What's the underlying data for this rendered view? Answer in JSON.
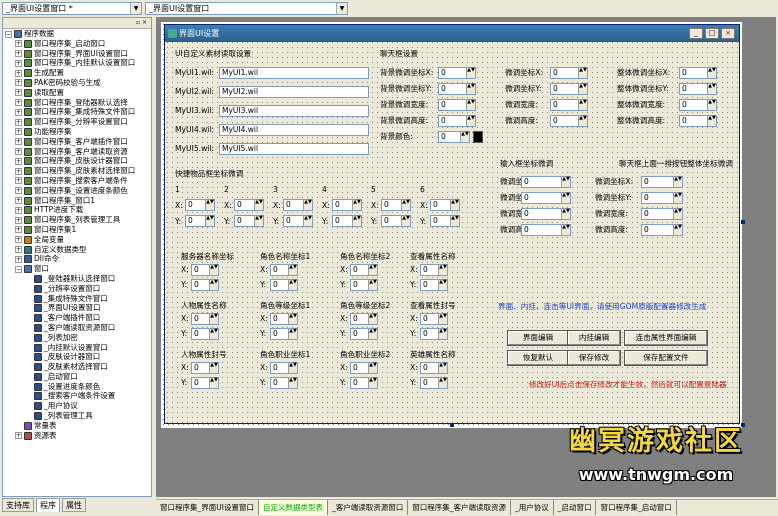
{
  "toolbar": {
    "combo_left": "_界面UI设置窗口 *",
    "combo_right": "_界面UI设置窗口"
  },
  "tree": {
    "header_icons": "▫ ×",
    "items": [
      {
        "label": "程序数据",
        "ex": "−",
        "icon": "folder-icon",
        "color": "#4a6fa5",
        "level": 0
      },
      {
        "label": "窗口程序集_启动窗口",
        "ex": "+",
        "icon": "module-icon",
        "color": "#5b8c3a",
        "level": 1
      },
      {
        "label": "窗口程序集_界面UI设置窗口",
        "ex": "+",
        "icon": "module-icon",
        "color": "#5b8c3a",
        "level": 1
      },
      {
        "label": "窗口程序集_内挂默认设置窗口",
        "ex": "+",
        "icon": "module-icon",
        "color": "#5b8c3a",
        "level": 1
      },
      {
        "label": "生成配置",
        "ex": "+",
        "icon": "module-icon",
        "color": "#5b8c3a",
        "level": 1
      },
      {
        "label": "PAK密码校验与生成",
        "ex": "+",
        "icon": "module-icon",
        "color": "#5b8c3a",
        "level": 1
      },
      {
        "label": "读取配置",
        "ex": "+",
        "icon": "module-icon",
        "color": "#5b8c3a",
        "level": 1
      },
      {
        "label": "窗口程序集_登陆器默认选择",
        "ex": "+",
        "icon": "module-icon",
        "color": "#5b8c3a",
        "level": 1
      },
      {
        "label": "窗口程序集_集成特殊文件窗口",
        "ex": "+",
        "icon": "module-icon",
        "color": "#5b8c3a",
        "level": 1
      },
      {
        "label": "窗口程序集_分辨率设置窗口",
        "ex": "+",
        "icon": "module-icon",
        "color": "#5b8c3a",
        "level": 1
      },
      {
        "label": "功能程序集",
        "ex": "+",
        "icon": "module-icon",
        "color": "#5b8c3a",
        "level": 1
      },
      {
        "label": "窗口程序集_客户端插件窗口",
        "ex": "+",
        "icon": "module-icon",
        "color": "#5b8c3a",
        "level": 1
      },
      {
        "label": "窗口程序集_客户端读取资源",
        "ex": "+",
        "icon": "module-icon",
        "color": "#5b8c3a",
        "level": 1
      },
      {
        "label": "窗口程序集_皮肤设计器窗口",
        "ex": "+",
        "icon": "module-icon",
        "color": "#5b8c3a",
        "level": 1
      },
      {
        "label": "窗口程序集_皮肤素材选择窗口",
        "ex": "+",
        "icon": "module-icon",
        "color": "#5b8c3a",
        "level": 1
      },
      {
        "label": "窗口程序集_搜索客户端条件",
        "ex": "+",
        "icon": "module-icon",
        "color": "#5b8c3a",
        "level": 1
      },
      {
        "label": "窗口程序集_设置进度条颜色",
        "ex": "+",
        "icon": "module-icon",
        "color": "#5b8c3a",
        "level": 1
      },
      {
        "label": "窗口程序集_窗口1",
        "ex": "+",
        "icon": "module-icon",
        "color": "#5b8c3a",
        "level": 1
      },
      {
        "label": "HTTP进度下载",
        "ex": "+",
        "icon": "module-icon",
        "color": "#5b8c3a",
        "level": 1
      },
      {
        "label": "窗口程序集_列表管理工具",
        "ex": "+",
        "icon": "module-icon",
        "color": "#5b8c3a",
        "level": 1
      },
      {
        "label": "窗口程序集1",
        "ex": "+",
        "icon": "module-icon",
        "color": "#5b8c3a",
        "level": 1
      },
      {
        "label": "全局变量",
        "ex": "+",
        "icon": "globe-icon",
        "color": "#b8860b",
        "level": 1
      },
      {
        "label": "自定义数据类型",
        "ex": "+",
        "icon": "type-icon",
        "color": "#2e7d7d",
        "level": 1
      },
      {
        "label": "Dll命令",
        "ex": "+",
        "icon": "dll-icon",
        "color": "#2e5d9d",
        "level": 1
      },
      {
        "label": "窗口",
        "ex": "−",
        "icon": "folder-icon",
        "color": "#4a6fa5",
        "level": 1
      },
      {
        "label": "_登陆器默认选择窗口",
        "ex": "",
        "icon": "window-icon",
        "color": "#2a4f8a",
        "level": 2
      },
      {
        "label": "_分辨率设置窗口",
        "ex": "",
        "icon": "window-icon",
        "color": "#2a4f8a",
        "level": 2
      },
      {
        "label": "_集成特殊文件窗口",
        "ex": "",
        "icon": "window-icon",
        "color": "#2a4f8a",
        "level": 2
      },
      {
        "label": "_界面UI设置窗口",
        "ex": "",
        "icon": "window-icon",
        "color": "#2a4f8a",
        "level": 2
      },
      {
        "label": "_客户端插件窗口",
        "ex": "",
        "icon": "window-icon",
        "color": "#2a4f8a",
        "level": 2
      },
      {
        "label": "_客户端读取资源窗口",
        "ex": "",
        "icon": "window-icon",
        "color": "#2a4f8a",
        "level": 2
      },
      {
        "label": "_列表加密",
        "ex": "",
        "icon": "window-icon",
        "color": "#2a4f8a",
        "level": 2
      },
      {
        "label": "_内挂默认设置窗口",
        "ex": "",
        "icon": "window-icon",
        "color": "#2a4f8a",
        "level": 2
      },
      {
        "label": "_皮肤设计器窗口",
        "ex": "",
        "icon": "window-icon",
        "color": "#2a4f8a",
        "level": 2
      },
      {
        "label": "_皮肤素材选择窗口",
        "ex": "",
        "icon": "window-icon",
        "color": "#2a4f8a",
        "level": 2
      },
      {
        "label": "_启动窗口",
        "ex": "",
        "icon": "window-icon",
        "color": "#2a4f8a",
        "level": 2
      },
      {
        "label": "_设置进度条颜色",
        "ex": "",
        "icon": "window-icon",
        "color": "#2a4f8a",
        "level": 2
      },
      {
        "label": "_搜索客户端条件设置",
        "ex": "",
        "icon": "window-icon",
        "color": "#2a4f8a",
        "level": 2
      },
      {
        "label": "_用户协议",
        "ex": "",
        "icon": "window-icon",
        "color": "#2a4f8a",
        "level": 2
      },
      {
        "label": "_列表管理工具",
        "ex": "",
        "icon": "window-icon",
        "color": "#2a4f8a",
        "level": 2
      },
      {
        "label": "常量表",
        "ex": "",
        "icon": "const-icon",
        "color": "#7a4fa5",
        "level": 1
      },
      {
        "label": "资源表",
        "ex": "+",
        "icon": "resource-icon",
        "color": "#a54f4f",
        "level": 1
      }
    ]
  },
  "bottom_tabs": [
    {
      "label": "支持库",
      "active": false
    },
    {
      "label": "程序",
      "active": true
    },
    {
      "label": "属性",
      "active": false
    }
  ],
  "window": {
    "title": "界面UI设置",
    "controls": [
      "_",
      "□",
      "×"
    ]
  },
  "wil": {
    "heading": "UI自定义素材读取设置",
    "rows": [
      {
        "label": "MyUI1.wil:",
        "value": "MyUI1.wil"
      },
      {
        "label": "MyUI2.wil:",
        "value": "MyUI2.wil"
      },
      {
        "label": "MyUI3.wil:",
        "value": "MyUI3.wil"
      },
      {
        "label": "MyUI4.wil:",
        "value": "MyUI4.wil"
      },
      {
        "label": "MyUI5.wil:",
        "value": "MyUI5.wil"
      }
    ]
  },
  "chat": {
    "heading": "聊天框设置",
    "col1": [
      {
        "label": "背景微调坐标X:",
        "value": "0"
      },
      {
        "label": "背景微调坐标Y:",
        "value": "0"
      },
      {
        "label": "背景微调宽度:",
        "value": "0"
      },
      {
        "label": "背景微调高度:",
        "value": "0"
      }
    ],
    "col2": [
      {
        "label": "微调坐标X:",
        "value": "0"
      },
      {
        "label": "微调坐标Y:",
        "value": "0"
      },
      {
        "label": "微调宽度:",
        "value": "0"
      },
      {
        "label": "微调高度:",
        "value": "0"
      }
    ],
    "col3": [
      {
        "label": "整体微调坐标X:",
        "value": "0"
      },
      {
        "label": "整体微调坐标Y:",
        "value": "0"
      },
      {
        "label": "整体微调宽度:",
        "value": "0"
      },
      {
        "label": "整体微调高度:",
        "value": "0"
      }
    ],
    "color_label": "背景颜色:",
    "color_value": "0",
    "swatch": "#000000"
  },
  "input_box": {
    "heading": "输入框坐标微调",
    "rows": [
      {
        "label": "微调坐标X:",
        "value": "0"
      },
      {
        "label": "微调坐标Y:",
        "value": "0"
      },
      {
        "label": "微调宽度:",
        "value": "0"
      },
      {
        "label": "微调高度:",
        "value": "0"
      }
    ]
  },
  "chat_buttons": {
    "heading": "聊天框上面一排按钮整体坐标微调",
    "rows": [
      {
        "label": "微调坐标X:",
        "value": "0"
      },
      {
        "label": "微调坐标Y:",
        "value": "0"
      },
      {
        "label": "微调宽度:",
        "value": "0"
      },
      {
        "label": "微调高度:",
        "value": "0"
      }
    ]
  },
  "quick": {
    "heading": "快捷物品框坐标微调",
    "slots": [
      {
        "num": "1",
        "x": "0",
        "y": "0"
      },
      {
        "num": "2",
        "x": "0",
        "y": "0"
      },
      {
        "num": "3",
        "x": "0",
        "y": "0"
      },
      {
        "num": "4",
        "x": "0",
        "y": "0"
      },
      {
        "num": "5",
        "x": "0",
        "y": "0"
      },
      {
        "num": "6",
        "x": "0",
        "y": "0"
      }
    ]
  },
  "coords": [
    {
      "label": "服务器名称坐标",
      "x": "0",
      "y": "0"
    },
    {
      "label": "角色名称坐标1",
      "x": "0",
      "y": "0"
    },
    {
      "label": "角色名称坐标2",
      "x": "0",
      "y": "0"
    },
    {
      "label": "查看属性名称",
      "x": "0",
      "y": "0"
    },
    {
      "label": "人物属性名称",
      "x": "0",
      "y": "0"
    },
    {
      "label": "角色等级坐标1",
      "x": "0",
      "y": "0"
    },
    {
      "label": "角色等级坐标2",
      "x": "0",
      "y": "0"
    },
    {
      "label": "查看属性封号",
      "x": "0",
      "y": "0"
    },
    {
      "label": "人物属性封号",
      "x": "0",
      "y": "0"
    },
    {
      "label": "角色职业坐标1",
      "x": "0",
      "y": "0"
    },
    {
      "label": "角色职业坐标2",
      "x": "0",
      "y": "0"
    },
    {
      "label": "英雄属性名称",
      "x": "0",
      "y": "0"
    }
  ],
  "axis": {
    "x": "X:",
    "y": "Y:"
  },
  "note_blue": "界面、内挂、连击等UI界面，请使用GOM原版配置器修改生成",
  "note_red": "修改好UI后点击保存修改才能生效，然后就可以配置登陆器",
  "action_buttons": [
    "界面编辑",
    "内挂编辑",
    "连击属性界面编辑",
    "恢复默认",
    "保存修改",
    "保存配置文件"
  ],
  "brand": {
    "line1": "幽冥游戏社区",
    "line2": "www.tnwgm.com"
  },
  "doc_tabs": [
    {
      "label": "窗口程序集_界面UI设置窗口",
      "active": false
    },
    {
      "label": "自定义数据类型表",
      "active": true
    },
    {
      "label": "_客户端读取资源窗口",
      "active": false
    },
    {
      "label": "窗口程序集_客户端读取资源",
      "active": false
    },
    {
      "label": "_用户协议",
      "active": false
    },
    {
      "label": "_启动窗口",
      "active": false
    },
    {
      "label": "窗口程序集_启动窗口",
      "active": false
    }
  ]
}
